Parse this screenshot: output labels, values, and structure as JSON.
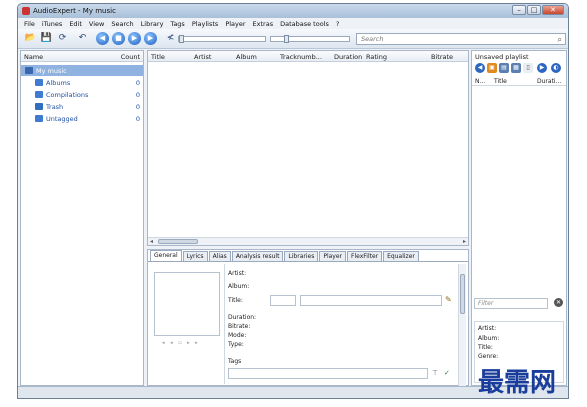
{
  "window": {
    "title": "AudioExpert - My music",
    "controls": {
      "minimize": "–",
      "maximize": "□",
      "close": "✕"
    }
  },
  "menu": [
    "File",
    "iTunes",
    "Edit",
    "View",
    "Search",
    "Library",
    "Tags",
    "Playlists",
    "Player",
    "Extras",
    "Database tools",
    "?"
  ],
  "toolbar": {
    "buttons": [
      {
        "name": "add-folder-icon",
        "glyph": "📂"
      },
      {
        "name": "save-icon",
        "glyph": "💾"
      },
      {
        "name": "refresh-icon",
        "glyph": "⟳"
      },
      {
        "name": "undo-icon",
        "glyph": "↶"
      },
      {
        "name": "back-icon",
        "glyph": "◀"
      },
      {
        "name": "stop-icon",
        "glyph": "■"
      },
      {
        "name": "play-icon",
        "glyph": "▶"
      },
      {
        "name": "next-icon",
        "glyph": "▶"
      },
      {
        "name": "share-icon",
        "glyph": "≮"
      }
    ],
    "position_fraction": 0.03,
    "volume_fraction": 0.2,
    "search_placeholder": "Search"
  },
  "library_tree": {
    "headers": {
      "name": "Name",
      "count": "Count"
    },
    "items": [
      {
        "label": "My music",
        "count": "",
        "selected": true,
        "color": "#3a66b0"
      },
      {
        "label": "Albums",
        "count": "0",
        "selected": false,
        "color": "#3f7bd0"
      },
      {
        "label": "Compilations",
        "count": "0",
        "selected": false,
        "color": "#3f7bd0"
      },
      {
        "label": "Trash",
        "count": "0",
        "selected": false,
        "color": "#2f6fc0"
      },
      {
        "label": "Untagged",
        "count": "0",
        "selected": false,
        "color": "#3f7bd0"
      }
    ]
  },
  "track_table": {
    "columns": [
      "Title",
      "Artist",
      "Album",
      "Tracknumb...",
      "Duration",
      "Rating",
      "Bitrate"
    ]
  },
  "detail_tabs": [
    "General",
    "Lyrics",
    "Alias",
    "Analysis result",
    "Libraries",
    "Player",
    "FlexFilter",
    "Equalizer"
  ],
  "detail": {
    "artist_label": "Artist:",
    "album_label": "Album:",
    "title_label": "Title:",
    "duration_label": "Duration:",
    "bitrate_label": "Bitrate:",
    "mode_label": "Mode:",
    "type_label": "Type:",
    "tags_label": "Tags"
  },
  "playlist": {
    "title": "Unsaved playlist",
    "columns": [
      "N...",
      "Title",
      "Durati..."
    ],
    "filter_placeholder": "Filter",
    "info_labels": [
      "Artist:",
      "Album:",
      "Title:",
      "Genre:"
    ]
  },
  "watermark": "最需网"
}
